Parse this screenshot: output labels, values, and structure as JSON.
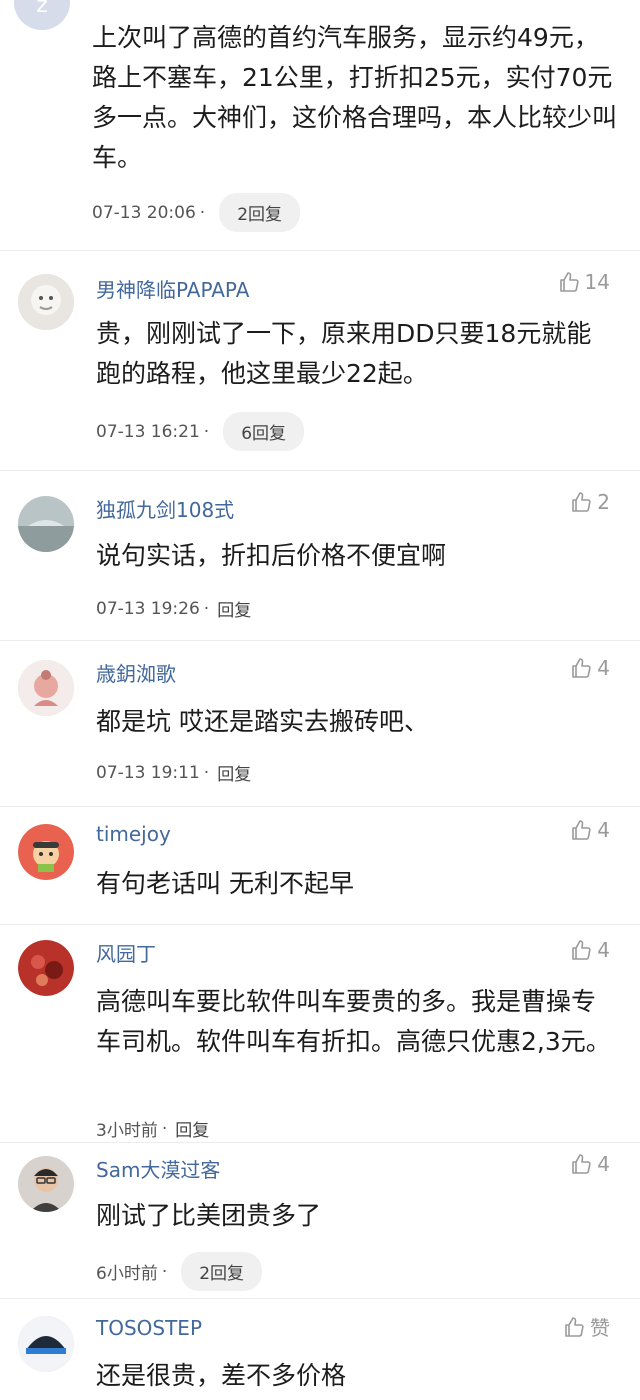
{
  "comments": [
    {
      "avatar": "reader-badge-avatar",
      "content": "上次叫了高德的首约汽车服务，显示约49元，路上不塞车，21公里，打折扣25元，实付70元多一点。大神们，这价格合理吗，本人比较少叫车。",
      "time": "07-13 20:06",
      "reply": "2回复"
    },
    {
      "username": "男神降临PAPAPA",
      "likes": "14",
      "content": "贵，刚刚试了一下，原来用DD只要18元就能跑的路程，他这里最少22起。",
      "time": "07-13 16:21",
      "reply": "6回复"
    },
    {
      "username": "独孤九剑108式",
      "likes": "2",
      "content": "说句实话，折扣后价格不便宜啊",
      "time": "07-13 19:26",
      "reply": "回复"
    },
    {
      "username": "歳鈅洳歌",
      "likes": "4",
      "content": "都是坑 哎还是踏实去搬砖吧、",
      "time": "07-13 19:11",
      "reply": "回复"
    },
    {
      "username": "timejoy",
      "likes": "4",
      "content": "有句老话叫 无利不起早"
    },
    {
      "username": "风园丁",
      "likes": "4",
      "content": "高德叫车要比软件叫车要贵的多。我是曹操专车司机。软件叫车有折扣。高德只优惠2,3元。",
      "time": "3小时前",
      "reply": "回复"
    },
    {
      "username": "Sam大漠过客",
      "likes": "4",
      "content": "刚试了比美团贵多了",
      "time": "6小时前",
      "reply": "2回复"
    },
    {
      "username": "TOSOSTEP",
      "likes": "赞",
      "content": "还是很贵，差不多价格"
    }
  ],
  "icons": {
    "like": "thumbs-up-icon"
  },
  "colors": {
    "username": "#43689c",
    "meta": "#555555",
    "like": "#9a9a9a",
    "reply_pill_bg": "#f0f0f0"
  }
}
